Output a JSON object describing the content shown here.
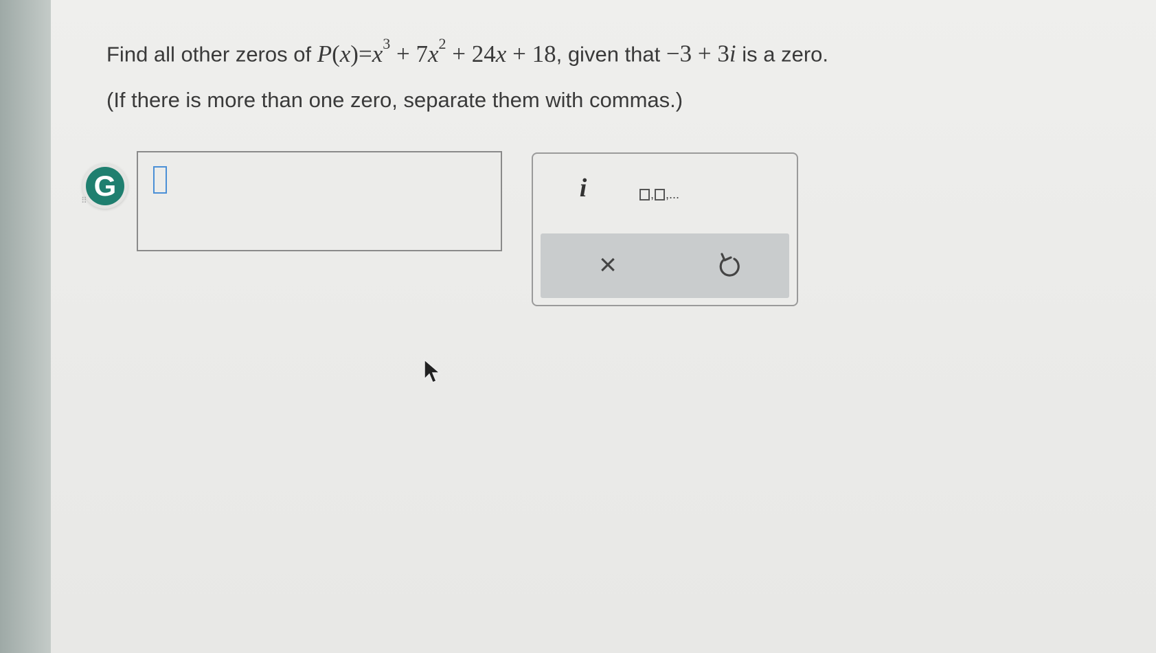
{
  "question": {
    "prefix": "Find all other zeros of ",
    "P": "P",
    "open": "(",
    "x": "x",
    "close": ")",
    "eq": "=",
    "term1_base": "x",
    "term1_exp": "3",
    "plus1": " + ",
    "term2_coef": "7",
    "term2_base": "x",
    "term2_exp": "2",
    "plus2": " + ",
    "term3_coef": "24",
    "term3_var": "x",
    "plus3": " + ",
    "const": "18",
    "mid": ", given that ",
    "given_real": "−3",
    "given_plus": " + ",
    "given_imag_coef": "3",
    "given_imag_unit": "i",
    "suffix": " is a zero."
  },
  "instruction": "(If there is more than one zero, separate them with commas.)",
  "badge": {
    "letter": "G",
    "color": "#1f7f6f"
  },
  "answer": {
    "value": ""
  },
  "palette": {
    "imag_unit_label": "i",
    "list_sep": ",",
    "list_ellipsis": ",...",
    "clear_label": "×",
    "icons": {
      "clear": "close-icon",
      "undo": "undo-icon",
      "list": "list-template-icon"
    }
  }
}
